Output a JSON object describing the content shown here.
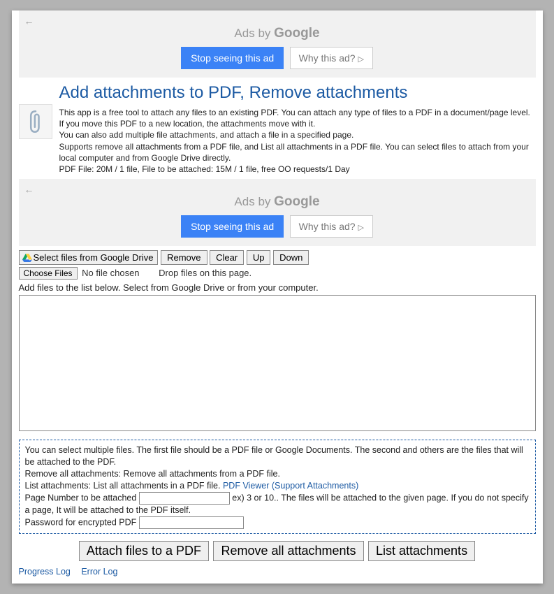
{
  "ads": {
    "by": "Ads by ",
    "google": "Google",
    "stop": "Stop seeing this ad",
    "why": "Why this ad?",
    "arrow": "←"
  },
  "title": "Add attachments to PDF, Remove attachments",
  "desc": {
    "l1": "This app is a free tool to attach any files to an existing PDF. You can attach any type of files to a PDF in a document/page level. If you move this PDF to a new location, the attachments move with it.",
    "l2": "You can also add multiple file attachments, and attach a file in a specified page.",
    "l3": "Supports remove all attachments from a PDF file, and List all attachments in a PDF file. You can select files to attach from your local computer and from Google Drive directly.",
    "l4": "PDF File: 20M / 1 file, File to be attached: 15M / 1 file, free OO requests/1 Day"
  },
  "toolbar": {
    "gdrive": "Select files from Google Drive",
    "remove": "Remove",
    "clear": "Clear",
    "up": "Up",
    "down": "Down"
  },
  "file": {
    "choose": "Choose Files",
    "nofile": "No file chosen",
    "drop": "Drop files on this page."
  },
  "instr": "Add files to the list below. Select from Google Drive or from your computer.",
  "help": {
    "l1": "You can select multiple files. The first file should be a PDF file or Google Documents. The second and others are the files that will be attached to the PDF.",
    "l2": "Remove all attachments: Remove all attachments from a PDF file.",
    "l3_a": "List attachments: List all attachments in a PDF file.  ",
    "l3_link": "PDF Viewer (Support Attachments)",
    "page_label": "Page Number to be attached ",
    "page_hint": " ex) 3 or 10.. The files will be attached to the given page. If you do not specify a page, It will be attached to the PDF itself.",
    "pwd_label": "Password for encrypted PDF "
  },
  "actions": {
    "attach": "Attach files to a PDF",
    "removeall": "Remove all attachments",
    "list": "List attachments"
  },
  "logs": {
    "progress": "Progress Log",
    "error": "Error Log"
  }
}
